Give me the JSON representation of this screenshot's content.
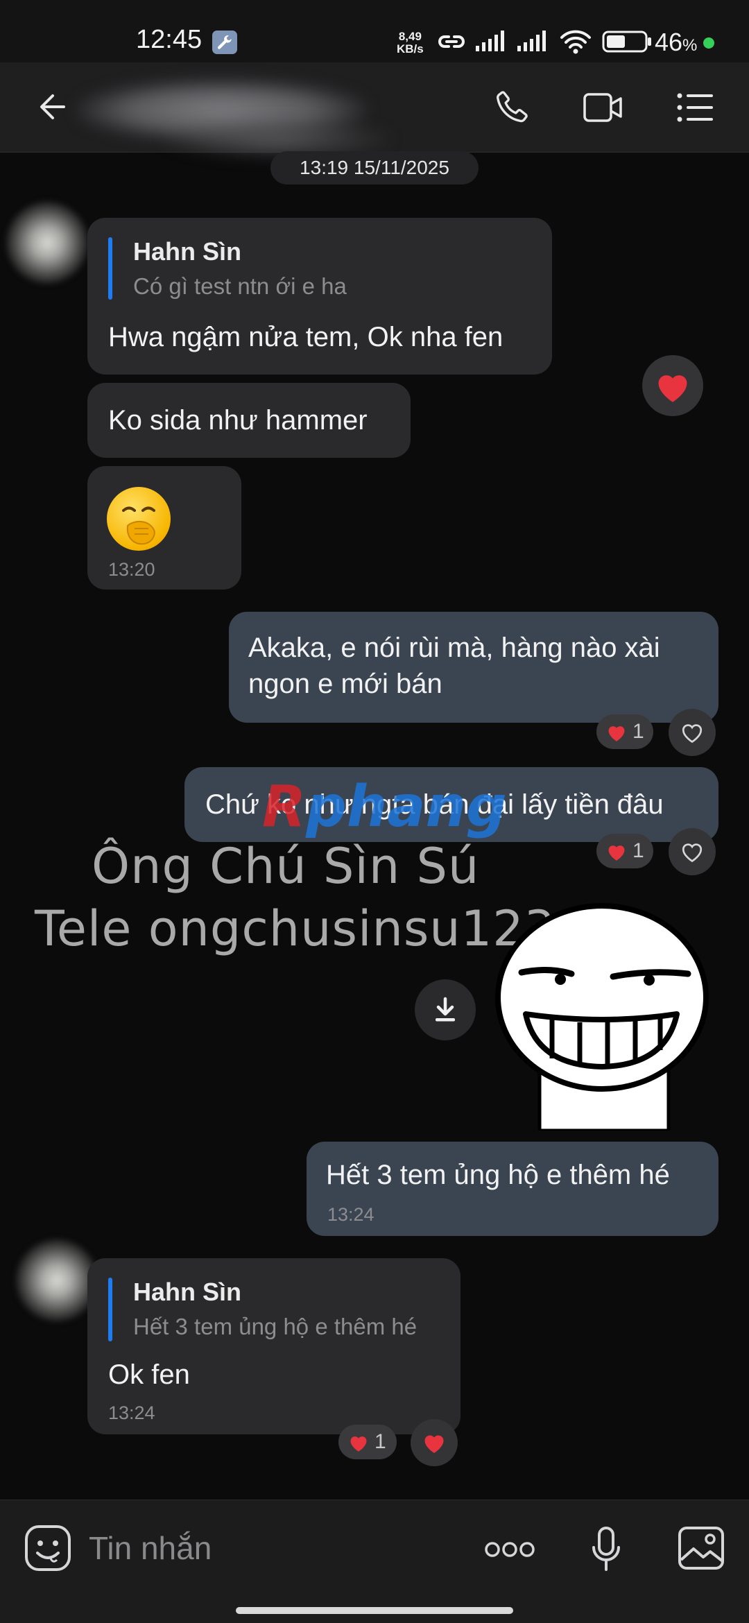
{
  "status_bar": {
    "time": "12:45",
    "net_speed_value": "8,49",
    "net_speed_unit": "KB/s",
    "battery_percent": "46",
    "battery_symbol": "%"
  },
  "header": {
    "contact_name": ""
  },
  "chat": {
    "date_separator": "13:19 15/11/2025",
    "messages": [
      {
        "direction": "in",
        "quote_name": "Hahn Sìn",
        "quote_text": "Có gì test ntn ới e ha",
        "text": "Hwa ngậm nửa tem, Ok nha fen"
      },
      {
        "direction": "in",
        "text": "Ko sida như hammer"
      },
      {
        "direction": "in",
        "time": "13:20"
      },
      {
        "direction": "out",
        "line1": "Akaka, e nói rùi mà, hàng nào xài",
        "line2": "ngon e mới bán",
        "reaction_count": "1"
      },
      {
        "direction": "out",
        "text": "Chứ ko như ngta bán đại lấy tiền đâu",
        "reaction_count": "1"
      },
      {
        "direction": "out",
        "text": "Hết 3 tem ủng hộ e thêm hé",
        "time": "13:24"
      },
      {
        "direction": "in",
        "quote_name": "Hahn Sìn",
        "quote_text": "Hết 3 tem ủng hộ e thêm hé",
        "text": "Ok fen",
        "time": "13:24",
        "reaction_count": "1"
      }
    ]
  },
  "watermark": {
    "line1": "Ông Chú Sìn Sú",
    "line2": "Tele ongchusinsu123",
    "logo_red": "R",
    "logo_blue": "phang"
  },
  "input": {
    "placeholder": "Tin nhắn"
  },
  "colors": {
    "background": "#0b0b0c",
    "incoming_bubble": "#2a2a2c",
    "outgoing_bubble": "#3b4552",
    "quote_bar": "#1e7bf0",
    "heart": "#e8343f"
  }
}
